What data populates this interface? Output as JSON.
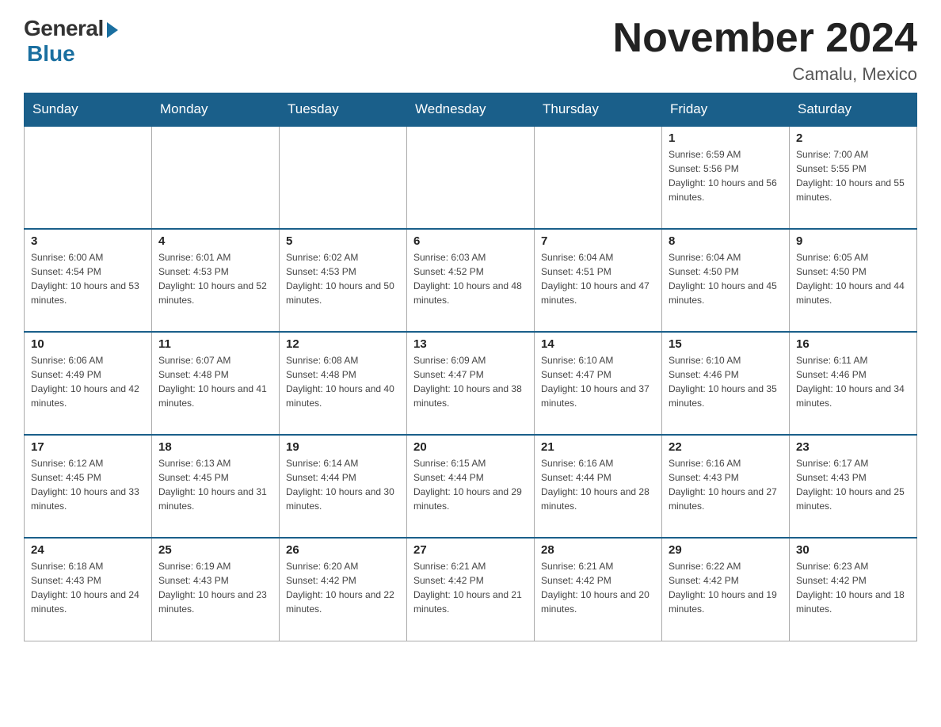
{
  "header": {
    "logo_general": "General",
    "logo_blue": "Blue",
    "month_title": "November 2024",
    "location": "Camalu, Mexico"
  },
  "days_of_week": [
    "Sunday",
    "Monday",
    "Tuesday",
    "Wednesday",
    "Thursday",
    "Friday",
    "Saturday"
  ],
  "weeks": [
    [
      {
        "day": "",
        "info": ""
      },
      {
        "day": "",
        "info": ""
      },
      {
        "day": "",
        "info": ""
      },
      {
        "day": "",
        "info": ""
      },
      {
        "day": "",
        "info": ""
      },
      {
        "day": "1",
        "info": "Sunrise: 6:59 AM\nSunset: 5:56 PM\nDaylight: 10 hours and 56 minutes."
      },
      {
        "day": "2",
        "info": "Sunrise: 7:00 AM\nSunset: 5:55 PM\nDaylight: 10 hours and 55 minutes."
      }
    ],
    [
      {
        "day": "3",
        "info": "Sunrise: 6:00 AM\nSunset: 4:54 PM\nDaylight: 10 hours and 53 minutes."
      },
      {
        "day": "4",
        "info": "Sunrise: 6:01 AM\nSunset: 4:53 PM\nDaylight: 10 hours and 52 minutes."
      },
      {
        "day": "5",
        "info": "Sunrise: 6:02 AM\nSunset: 4:53 PM\nDaylight: 10 hours and 50 minutes."
      },
      {
        "day": "6",
        "info": "Sunrise: 6:03 AM\nSunset: 4:52 PM\nDaylight: 10 hours and 48 minutes."
      },
      {
        "day": "7",
        "info": "Sunrise: 6:04 AM\nSunset: 4:51 PM\nDaylight: 10 hours and 47 minutes."
      },
      {
        "day": "8",
        "info": "Sunrise: 6:04 AM\nSunset: 4:50 PM\nDaylight: 10 hours and 45 minutes."
      },
      {
        "day": "9",
        "info": "Sunrise: 6:05 AM\nSunset: 4:50 PM\nDaylight: 10 hours and 44 minutes."
      }
    ],
    [
      {
        "day": "10",
        "info": "Sunrise: 6:06 AM\nSunset: 4:49 PM\nDaylight: 10 hours and 42 minutes."
      },
      {
        "day": "11",
        "info": "Sunrise: 6:07 AM\nSunset: 4:48 PM\nDaylight: 10 hours and 41 minutes."
      },
      {
        "day": "12",
        "info": "Sunrise: 6:08 AM\nSunset: 4:48 PM\nDaylight: 10 hours and 40 minutes."
      },
      {
        "day": "13",
        "info": "Sunrise: 6:09 AM\nSunset: 4:47 PM\nDaylight: 10 hours and 38 minutes."
      },
      {
        "day": "14",
        "info": "Sunrise: 6:10 AM\nSunset: 4:47 PM\nDaylight: 10 hours and 37 minutes."
      },
      {
        "day": "15",
        "info": "Sunrise: 6:10 AM\nSunset: 4:46 PM\nDaylight: 10 hours and 35 minutes."
      },
      {
        "day": "16",
        "info": "Sunrise: 6:11 AM\nSunset: 4:46 PM\nDaylight: 10 hours and 34 minutes."
      }
    ],
    [
      {
        "day": "17",
        "info": "Sunrise: 6:12 AM\nSunset: 4:45 PM\nDaylight: 10 hours and 33 minutes."
      },
      {
        "day": "18",
        "info": "Sunrise: 6:13 AM\nSunset: 4:45 PM\nDaylight: 10 hours and 31 minutes."
      },
      {
        "day": "19",
        "info": "Sunrise: 6:14 AM\nSunset: 4:44 PM\nDaylight: 10 hours and 30 minutes."
      },
      {
        "day": "20",
        "info": "Sunrise: 6:15 AM\nSunset: 4:44 PM\nDaylight: 10 hours and 29 minutes."
      },
      {
        "day": "21",
        "info": "Sunrise: 6:16 AM\nSunset: 4:44 PM\nDaylight: 10 hours and 28 minutes."
      },
      {
        "day": "22",
        "info": "Sunrise: 6:16 AM\nSunset: 4:43 PM\nDaylight: 10 hours and 27 minutes."
      },
      {
        "day": "23",
        "info": "Sunrise: 6:17 AM\nSunset: 4:43 PM\nDaylight: 10 hours and 25 minutes."
      }
    ],
    [
      {
        "day": "24",
        "info": "Sunrise: 6:18 AM\nSunset: 4:43 PM\nDaylight: 10 hours and 24 minutes."
      },
      {
        "day": "25",
        "info": "Sunrise: 6:19 AM\nSunset: 4:43 PM\nDaylight: 10 hours and 23 minutes."
      },
      {
        "day": "26",
        "info": "Sunrise: 6:20 AM\nSunset: 4:42 PM\nDaylight: 10 hours and 22 minutes."
      },
      {
        "day": "27",
        "info": "Sunrise: 6:21 AM\nSunset: 4:42 PM\nDaylight: 10 hours and 21 minutes."
      },
      {
        "day": "28",
        "info": "Sunrise: 6:21 AM\nSunset: 4:42 PM\nDaylight: 10 hours and 20 minutes."
      },
      {
        "day": "29",
        "info": "Sunrise: 6:22 AM\nSunset: 4:42 PM\nDaylight: 10 hours and 19 minutes."
      },
      {
        "day": "30",
        "info": "Sunrise: 6:23 AM\nSunset: 4:42 PM\nDaylight: 10 hours and 18 minutes."
      }
    ]
  ]
}
